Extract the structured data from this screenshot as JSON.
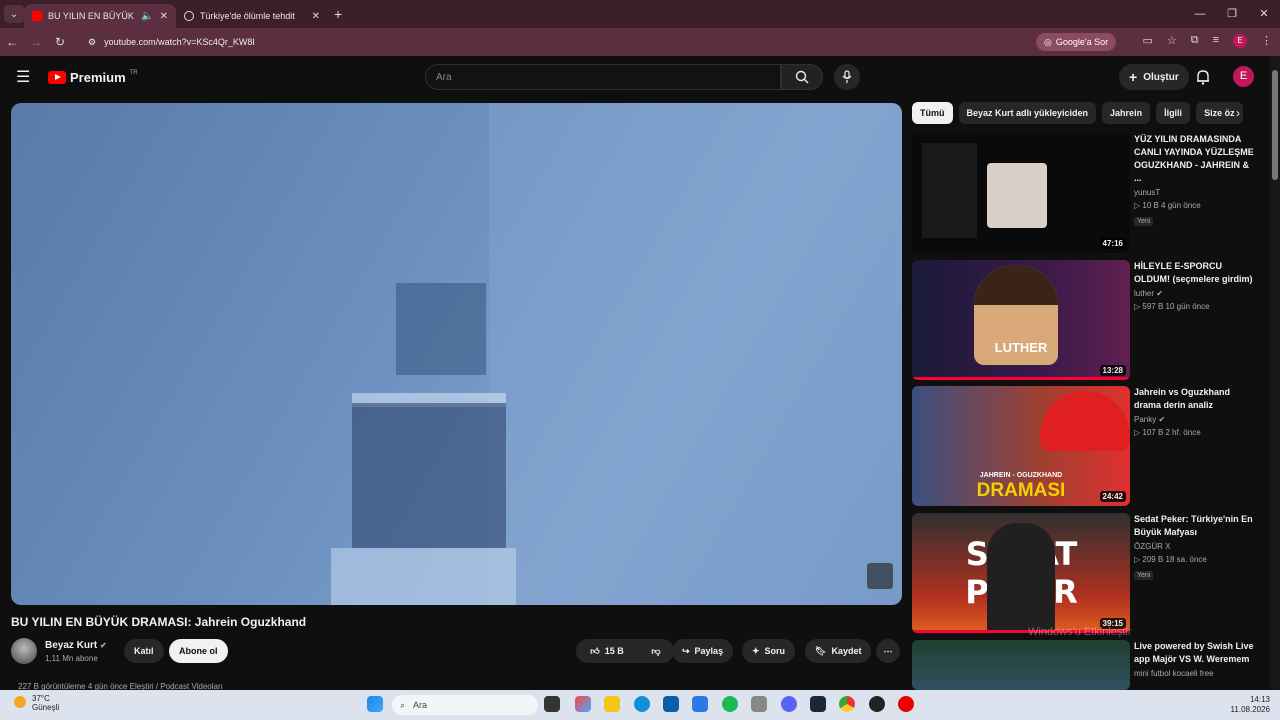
{
  "browser": {
    "tabs": [
      {
        "title": "BU YILIN EN BÜYÜK DRAMA",
        "active": true
      },
      {
        "title": "Türkiye'de ölümle tehdit",
        "active": false
      }
    ],
    "url": "youtube.com/watch?v=KSc4Qr_KW8I",
    "ask_google": "Google'a Sor",
    "profile_letter": "E"
  },
  "youtube": {
    "logo_text": "Premium",
    "logo_region": "TR",
    "search_placeholder": "Ara",
    "create_label": "Oluştur",
    "avatar_letter": "E"
  },
  "video": {
    "title": "BU YILIN EN BÜYÜK DRAMASI: Jahrein Oguzkhand",
    "channel_name": "Beyaz Kurt",
    "subscribers": "1,11 Mn abone",
    "join_label": "Katıl",
    "subscribe_label": "Abone ol",
    "like_count": "15 B",
    "share_label": "Paylaş",
    "ask_label": "Soru",
    "save_label": "Kaydet",
    "description_peek": "227 B görüntüleme  4 gün önce  Eleştiri / Podcast Videoları"
  },
  "chips": [
    "Tümü",
    "Beyaz Kurt adlı yükleyiciden",
    "Jahrein",
    "İlgili",
    "Size öz"
  ],
  "recommendations": [
    {
      "title": "YÜZ YILIN DRAMASINDA CANLI YAYINDA YÜZLEŞME OGUZKHAND - JAHREIN & ...",
      "channel": "yunusT",
      "meta": "▷ 10 B  4 gün önce",
      "badge": "Yeni",
      "duration": "47:16"
    },
    {
      "title": "HİLEYLE E-SPORCU OLDUM! (seçmelere girdim)",
      "channel": "luther",
      "meta": "▷ 597 B  10 gün önce",
      "badge": "",
      "duration": "13:28"
    },
    {
      "title": "Jahrein vs Oguzkhand drama derin analiz",
      "channel": "Panky",
      "meta": "▷ 107 B  2 hf. önce",
      "badge": "",
      "duration": "24:42"
    },
    {
      "title": "Sedat Peker: Türkiye'nin En Büyük Mafyası",
      "channel": "ÖZGÜR X",
      "meta": "▷ 209 B  18 sa. önce",
      "badge": "Yeni",
      "duration": "39:15"
    },
    {
      "title": "Live powered by Swish Live app Majör VS W. Weremem",
      "channel": "mini futbol kocaeli free",
      "meta": "",
      "badge": "",
      "duration": ""
    }
  ],
  "thumb_text": {
    "luther": "LUTHER",
    "dramasi_top": "JAHREIN - OGUZKHAND",
    "dramasi": "DRAMASI",
    "sedat": "SEDAT PEKER"
  },
  "watermark": "Windows'u Etkinleştir",
  "taskbar": {
    "temp": "37°C",
    "weather": "Güneşli",
    "search": "Ara",
    "time": "14:13",
    "date": "11.08.2026"
  }
}
